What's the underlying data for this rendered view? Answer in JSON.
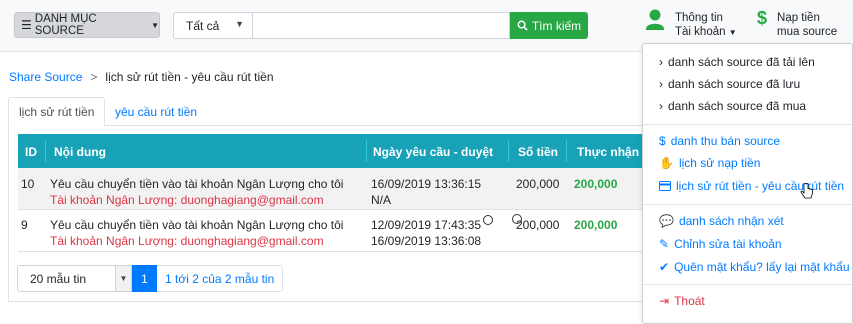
{
  "header": {
    "category_button": "DANH MỤC SOURCE",
    "category_icon": "list-icon",
    "search_select_value": "Tất cả",
    "search_input_value": "",
    "search_button": "Tìm kiếm",
    "user_line1": "Thông tin",
    "user_line2": "Tài khoản",
    "money_line1": "Nạp tiền",
    "money_line2": "mua source",
    "colors": {
      "green": "#28a745",
      "blue": "#007bff",
      "teal": "#17a2b8",
      "red": "#dc3545"
    }
  },
  "breadcrumb": {
    "home": "Share Source",
    "separator": ">",
    "current": "lịch sử rút tiền - yêu cầu rút tiền"
  },
  "tabs": [
    {
      "label": "lịch sử rút tiền",
      "active": true
    },
    {
      "label": "yêu cầu rút tiền",
      "active": false
    }
  ],
  "table": {
    "headers": [
      "ID",
      "Nội dung",
      "Ngày yêu cầu - duyệt",
      "Số tiền",
      "Thực nhận"
    ],
    "rows": [
      {
        "id": "10",
        "content": "Yêu cầu chuyển tiền vào tài khoản Ngân Lượng cho tôi",
        "account_label": "Tài khoản Ngân Lượng:",
        "account_email": "duonghagiang@gmail.com",
        "date_request": "16/09/2019 13:36:15",
        "date_approve": "N/A",
        "amount": "200,000",
        "received": "200,000"
      },
      {
        "id": "9",
        "content": "Yêu cầu chuyển tiền vào tài khoản Ngân Lượng cho tôi",
        "account_label": "Tài khoản Ngân Lượng:",
        "account_email": "duonghagiang@gmail.com",
        "date_request": "12/09/2019 17:43:35",
        "date_approve": "16/09/2019 13:36:08",
        "amount": "200,000",
        "received": "200,000"
      }
    ]
  },
  "pager": {
    "per_page": "20 mẫu tin",
    "page": "1",
    "info": "1 tới 2 của 2 mẫu tin"
  },
  "dropdown": {
    "group1": [
      "danh sách source đã tải lên",
      "danh sách source đã lưu",
      "danh sách source đã mua"
    ],
    "group2": [
      "danh thu bán source",
      "lịch sử nạp tiền",
      "lịch sử rút tiền - yêu cầu rút tiền"
    ],
    "group3": [
      "danh sách nhận xét",
      "Chỉnh sửa tài khoản",
      "Quên mật khẩu? lấy lại mật khẩu"
    ],
    "logout": "Thoát"
  }
}
